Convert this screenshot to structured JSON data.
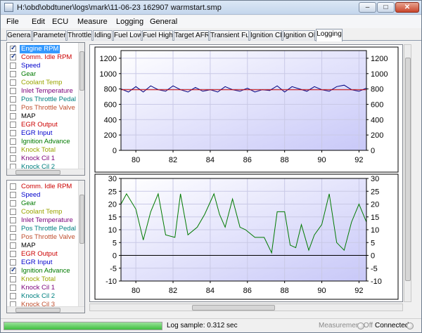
{
  "window": {
    "title": "H:\\obd\\obdtuner\\logs\\mark\\11-06-23 162907 warmstart.smp",
    "minimize_label": "–",
    "maximize_label": "□",
    "close_label": "✕"
  },
  "menu": [
    "File",
    "Edit",
    "ECU",
    "Measure",
    "Logging",
    "General"
  ],
  "tabs": [
    {
      "label": "General",
      "active": false
    },
    {
      "label": "Parameters",
      "active": false
    },
    {
      "label": "Throttle",
      "active": false
    },
    {
      "label": "Idling",
      "active": false
    },
    {
      "label": "Fuel Low",
      "active": false
    },
    {
      "label": "Fuel High",
      "active": false
    },
    {
      "label": "Target AFR",
      "active": false
    },
    {
      "label": "Transient Fuel",
      "active": false
    },
    {
      "label": "Ignition CL",
      "active": false
    },
    {
      "label": "Ignition OL",
      "active": false
    },
    {
      "label": "Logging",
      "active": true
    }
  ],
  "channels_top": [
    {
      "label": "Engine RPM",
      "checked": true,
      "color": "#0000cc",
      "selected": true
    },
    {
      "label": "Comm. Idle RPM",
      "checked": true,
      "color": "#cc0000",
      "selected": false
    },
    {
      "label": "Speed",
      "checked": false,
      "color": "#0000cc",
      "selected": false
    },
    {
      "label": "Gear",
      "checked": false,
      "color": "#007a00",
      "selected": false
    },
    {
      "label": "Coolant Temp",
      "checked": false,
      "color": "#9aa400",
      "selected": false
    },
    {
      "label": "Inlet Temperature",
      "checked": false,
      "color": "#7a007a",
      "selected": false
    },
    {
      "label": "Pos Throttle Pedal",
      "checked": false,
      "color": "#008080",
      "selected": false
    },
    {
      "label": "Pos Throttle Valve",
      "checked": false,
      "color": "#c05030",
      "selected": false
    },
    {
      "label": "MAP",
      "checked": false,
      "color": "#000000",
      "selected": false
    },
    {
      "label": "EGR Output",
      "checked": false,
      "color": "#cc0000",
      "selected": false
    },
    {
      "label": "EGR Input",
      "checked": false,
      "color": "#0000cc",
      "selected": false
    },
    {
      "label": "Ignition Advance",
      "checked": false,
      "color": "#007a00",
      "selected": false
    },
    {
      "label": "Knock Total",
      "checked": false,
      "color": "#9aa400",
      "selected": false
    },
    {
      "label": "Knock Cil 1",
      "checked": false,
      "color": "#7a007a",
      "selected": false
    },
    {
      "label": "Knock Cil 2",
      "checked": false,
      "color": "#008080",
      "selected": false
    }
  ],
  "channels_bottom": [
    {
      "label": "Comm. Idle RPM",
      "checked": false,
      "color": "#cc0000"
    },
    {
      "label": "Speed",
      "checked": false,
      "color": "#0000cc"
    },
    {
      "label": "Gear",
      "checked": false,
      "color": "#007a00"
    },
    {
      "label": "Coolant Temp",
      "checked": false,
      "color": "#9aa400"
    },
    {
      "label": "Inlet Temperature",
      "checked": false,
      "color": "#7a007a"
    },
    {
      "label": "Pos Throttle Pedal",
      "checked": false,
      "color": "#008080"
    },
    {
      "label": "Pos Throttle Valve",
      "checked": false,
      "color": "#c05030"
    },
    {
      "label": "MAP",
      "checked": false,
      "color": "#000000"
    },
    {
      "label": "EGR Output",
      "checked": false,
      "color": "#cc0000"
    },
    {
      "label": "EGR Input",
      "checked": false,
      "color": "#0000cc"
    },
    {
      "label": "Ignition Advance",
      "checked": true,
      "color": "#007a00"
    },
    {
      "label": "Knock Total",
      "checked": false,
      "color": "#9aa400"
    },
    {
      "label": "Knock Cil 1",
      "checked": false,
      "color": "#7a007a"
    },
    {
      "label": "Knock Cil 2",
      "checked": false,
      "color": "#008080"
    },
    {
      "label": "Knock Cil 3",
      "checked": false,
      "color": "#c05030"
    }
  ],
  "chart_data": [
    {
      "type": "line",
      "xlim": [
        79.2,
        92.4
      ],
      "ylim": [
        0,
        1300
      ],
      "xticks": [
        80,
        82,
        84,
        86,
        88,
        90,
        92
      ],
      "yticks": [
        0,
        200,
        400,
        600,
        800,
        1000,
        1200
      ],
      "grid": true,
      "series": [
        {
          "color": "#000080",
          "x": [
            79.2,
            79.6,
            80.0,
            80.4,
            80.8,
            81.2,
            81.6,
            82.0,
            82.4,
            82.8,
            83.2,
            83.6,
            84.0,
            84.4,
            84.8,
            85.2,
            85.6,
            86.0,
            86.4,
            86.8,
            87.2,
            87.6,
            88.0,
            88.4,
            88.8,
            89.2,
            89.6,
            90.0,
            90.4,
            90.8,
            91.2,
            91.6,
            92.0,
            92.4
          ],
          "y": [
            800,
            760,
            830,
            760,
            840,
            790,
            770,
            840,
            790,
            760,
            820,
            770,
            790,
            760,
            830,
            790,
            770,
            810,
            760,
            790,
            780,
            840,
            760,
            830,
            800,
            770,
            830,
            790,
            770,
            830,
            850,
            790,
            770,
            810
          ]
        },
        {
          "color": "#cc0000",
          "x": [
            79.2,
            92.4
          ],
          "y": [
            790,
            790
          ]
        }
      ]
    },
    {
      "type": "line",
      "xlim": [
        79.2,
        92.4
      ],
      "ylim": [
        -10,
        30
      ],
      "xticks": [
        80,
        82,
        84,
        86,
        88,
        90,
        92
      ],
      "yticks": [
        -10,
        -5,
        0,
        5,
        10,
        15,
        20,
        25,
        30
      ],
      "grid": true,
      "zero_line": true,
      "series": [
        {
          "color": "#007a00",
          "x": [
            79.2,
            79.5,
            80.0,
            80.4,
            80.8,
            81.2,
            81.6,
            82.1,
            82.4,
            82.8,
            83.3,
            83.7,
            84.2,
            84.5,
            84.8,
            85.2,
            85.6,
            85.9,
            86.4,
            86.9,
            87.3,
            87.6,
            88.0,
            88.3,
            88.6,
            88.9,
            89.3,
            89.6,
            90.0,
            90.4,
            90.8,
            91.2,
            91.6,
            92.0,
            92.4
          ],
          "y": [
            20,
            24,
            18,
            6,
            17,
            24,
            8,
            7,
            24,
            8,
            11,
            16,
            24,
            16,
            11,
            22,
            11,
            10,
            7,
            7,
            1,
            17,
            17,
            4,
            3,
            12,
            2,
            8,
            12,
            24,
            5,
            2,
            13,
            20,
            13
          ]
        }
      ]
    }
  ],
  "status": {
    "progress_fraction": 1.0,
    "log_sample": "Log sample: 0.312 sec",
    "measurement": "Measurement Off",
    "connected": "Connected"
  }
}
